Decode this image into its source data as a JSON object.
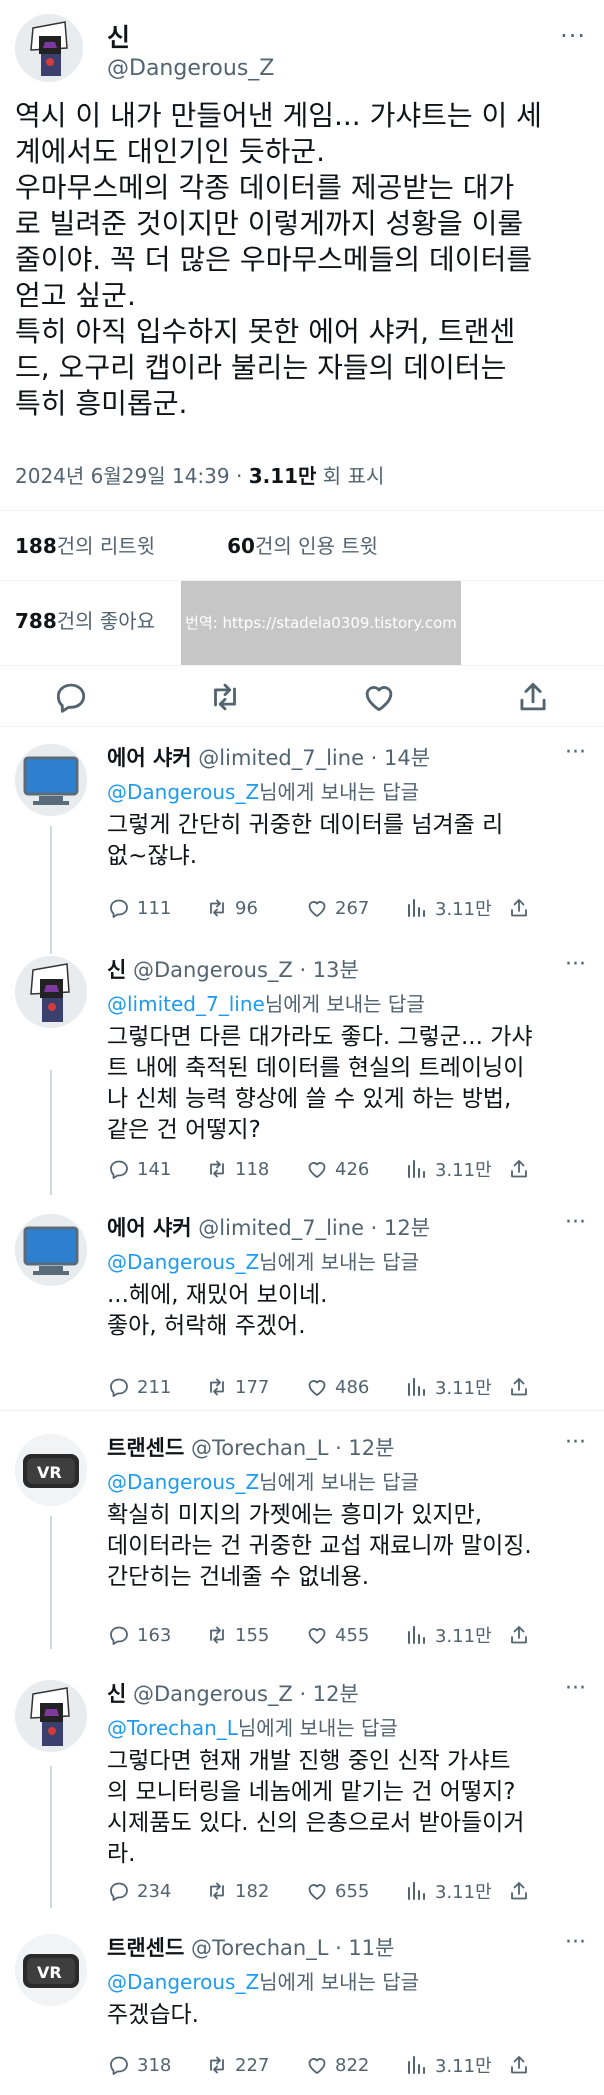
{
  "main_tweet": {
    "name": "신",
    "handle": "@Dangerous_Z",
    "more": "···",
    "body": "역시 이 내가 만들어낸 게임... 가샤트는 이 세\n계에서도 대인기인 듯하군.\n우마무스메의 각종 데이터를 제공받는 대가\n로 빌려준 것이지만 이렇게까지 성황을 이룰\n줄이야. 꼭 더 많은 우마무스메들의 데이터를\n얻고 싶군.\n특히 아직 입수하지 못한 에어 샤커, 트랜센\n드, 오구리 캡이라 불리는 자들의 데이터는\n특히 흥미롭군.",
    "date": "2024년 6월29일 14:39 · ",
    "views_value": "3.11만",
    "views_label": " 회 표시",
    "retweets_count": "188",
    "retweets_label": "건의 리트윗",
    "quotes_count": "60",
    "quotes_label": "건의 인용 트윗",
    "likes_count": "788",
    "likes_label": "건의 좋아요",
    "watermark": "번역: https://stadela0309.tistory.com"
  },
  "replies": [
    {
      "name": "에어 샤커",
      "handle": "@limited_7_line · 14분",
      "mention": "@Dangerous_Z",
      "to_suffix": "님에게 보내는 답글",
      "body": "그렇게 간단히 귀중한 데이터를 넘겨줄 리\n없~잖냐.",
      "replies": "111",
      "retweets": "96",
      "likes": "267",
      "views": "3.11만"
    },
    {
      "name": "신",
      "handle": "@Dangerous_Z · 13분",
      "mention": "@limited_7_line",
      "to_suffix": "님에게 보내는 답글",
      "body": "그렇다면 다른 대가라도 좋다. 그렇군... 가샤\n트 내에 축적된 데이터를 현실의 트레이닝이\n나 신체 능력 향상에 쓸 수 있게 하는 방법,\n같은 건 어떻지?",
      "replies": "141",
      "retweets": "118",
      "likes": "426",
      "views": "3.11만"
    },
    {
      "name": "에어 샤커",
      "handle": "@limited_7_line · 12분",
      "mention": "@Dangerous_Z",
      "to_suffix": "님에게 보내는 답글",
      "body": "...헤에, 재밌어 보이네.\n좋아, 허락해 주겠어.",
      "replies": "211",
      "retweets": "177",
      "likes": "486",
      "views": "3.11만"
    },
    {
      "name": "트랜센드",
      "handle": "@Torechan_L · 12분",
      "mention": "@Dangerous_Z",
      "to_suffix": "님에게 보내는 답글",
      "body": "확실히 미지의 가젯에는 흥미가 있지만,\n데이터라는 건 귀중한 교섭 재료니까 말이징.\n간단히는 건네줄 수 없네용.",
      "replies": "163",
      "retweets": "155",
      "likes": "455",
      "views": "3.11만"
    },
    {
      "name": "신",
      "handle": "@Dangerous_Z · 12분",
      "mention": "@Torechan_L",
      "to_suffix": "님에게 보내는 답글",
      "body": "그렇다면 현재 개발 진행 중인 신작 가샤트\n의 모니터링을 네놈에게 맡기는 건 어떻지?\n시제품도 있다. 신의 은총으로서 받아들이거\n라.",
      "replies": "234",
      "retweets": "182",
      "likes": "655",
      "views": "3.11만"
    },
    {
      "name": "트랜센드",
      "handle": "@Torechan_L · 11분",
      "mention": "@Dangerous_Z",
      "to_suffix": "님에게 보내는 답글",
      "body": "주겠습다.",
      "replies": "318",
      "retweets": "227",
      "likes": "822",
      "views": "3.11만"
    }
  ],
  "more_label": "···",
  "avatars": {
    "god": "god-avatar",
    "shakur": "monitor-avatar",
    "transcend": "vr-headset-avatar"
  },
  "colors": {
    "link": "#1d9bf0",
    "secondary": "#536471",
    "text": "#0f1419",
    "border": "#eff3f4"
  }
}
